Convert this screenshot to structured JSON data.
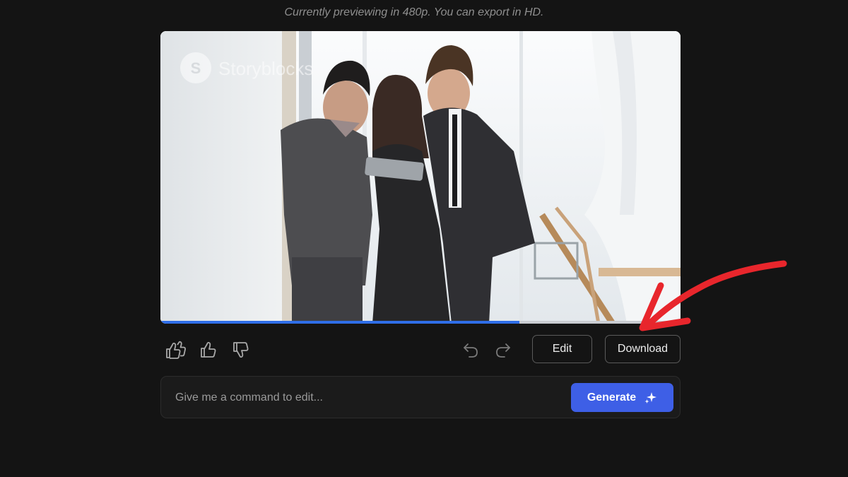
{
  "preview_note": "Currently previewing in 480p. You can export in HD.",
  "video": {
    "watermark": "Storyblocks",
    "progress": 0.69
  },
  "toolbar": {
    "edit_label": "Edit",
    "download_label": "Download"
  },
  "command": {
    "placeholder": "Give me a command to edit...",
    "generate_label": "Generate"
  },
  "colors": {
    "background": "#141414",
    "accent": "#3e5fe6",
    "progress": "#2f6ee8",
    "annotation": "#e8262c"
  },
  "icons": [
    "double-thumbs-up-icon",
    "thumbs-up-icon",
    "thumbs-down-icon",
    "undo-icon",
    "redo-icon",
    "sparkle-icon",
    "storyblocks-logo-icon"
  ]
}
